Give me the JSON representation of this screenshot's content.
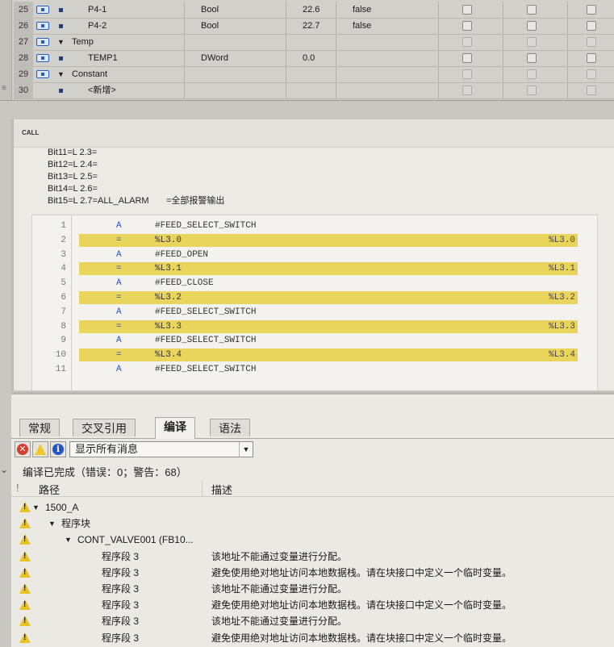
{
  "interface_table": {
    "rows": [
      {
        "num": "25",
        "kind": "var",
        "name": "P4-1",
        "type": "Bool",
        "offset": "22.6",
        "default": "false"
      },
      {
        "num": "26",
        "kind": "var",
        "name": "P4-2",
        "type": "Bool",
        "offset": "22.7",
        "default": "false"
      },
      {
        "num": "27",
        "kind": "section",
        "name": "Temp",
        "type": "",
        "offset": "",
        "default": ""
      },
      {
        "num": "28",
        "kind": "var",
        "name": "TEMP1",
        "type": "DWord",
        "offset": "0.0",
        "default": ""
      },
      {
        "num": "29",
        "kind": "section",
        "name": "Constant",
        "type": "",
        "offset": "",
        "default": ""
      },
      {
        "num": "30",
        "kind": "add",
        "name": "<新增>",
        "type": "",
        "offset": "",
        "default": ""
      }
    ]
  },
  "editor": {
    "call_label": "CALL",
    "comment_lines": [
      "Bit11=L 2.3=",
      "Bit12=L 2.4=",
      "Bit13=L 2.5=",
      "Bit14=L 2.6=",
      "Bit15=L 2.7=ALL_ALARM       =全部报警输出"
    ],
    "code_lines": [
      {
        "ln": "1",
        "op": "A",
        "arg": "#FEED_SELECT_SWITCH",
        "res": "",
        "hl": false
      },
      {
        "ln": "2",
        "op": "=",
        "arg": "%L3.0",
        "res": "%L3.0",
        "hl": true
      },
      {
        "ln": "3",
        "op": "A",
        "arg": "#FEED_OPEN",
        "res": "",
        "hl": false
      },
      {
        "ln": "4",
        "op": "=",
        "arg": "%L3.1",
        "res": "%L3.1",
        "hl": true
      },
      {
        "ln": "5",
        "op": "A",
        "arg": "#FEED_CLOSE",
        "res": "",
        "hl": false
      },
      {
        "ln": "6",
        "op": "=",
        "arg": "%L3.2",
        "res": "%L3.2",
        "hl": true
      },
      {
        "ln": "7",
        "op": "A",
        "arg": "#FEED_SELECT_SWITCH",
        "res": "",
        "hl": false
      },
      {
        "ln": "8",
        "op": "=",
        "arg": "%L3.3",
        "res": "%L3.3",
        "hl": true
      },
      {
        "ln": "9",
        "op": "A",
        "arg": "#FEED_SELECT_SWITCH",
        "res": "",
        "hl": false
      },
      {
        "ln": "10",
        "op": "=",
        "arg": "%L3.4",
        "res": "%L3.4",
        "hl": true
      },
      {
        "ln": "11",
        "op": "A",
        "arg": "#FEED_SELECT_SWITCH",
        "res": "",
        "hl": false
      }
    ]
  },
  "panel": {
    "tabs": [
      "常规",
      "交叉引用",
      "编译",
      "语法"
    ],
    "active_tab": "编译",
    "filter_value": "显示所有消息",
    "status": "编译已完成（错误：0；警告：68）",
    "header": {
      "path": "路径",
      "desc": "描述"
    },
    "messages": [
      {
        "level": 0,
        "path": "1500_A",
        "desc": ""
      },
      {
        "level": 1,
        "path": "程序块",
        "desc": ""
      },
      {
        "level": 2,
        "path": "CONT_VALVE001 (FB10...",
        "desc": ""
      },
      {
        "level": 3,
        "path": "程序段 3",
        "desc": "该地址不能通过变量进行分配。"
      },
      {
        "level": 3,
        "path": "程序段 3",
        "desc": "避免使用绝对地址访问本地数据栈。请在块接口中定义一个临时变量。"
      },
      {
        "level": 3,
        "path": "程序段 3",
        "desc": "该地址不能通过变量进行分配。"
      },
      {
        "level": 3,
        "path": "程序段 3",
        "desc": "避免使用绝对地址访问本地数据栈。请在块接口中定义一个临时变量。"
      },
      {
        "level": 3,
        "path": "程序段 3",
        "desc": "该地址不能通过变量进行分配。"
      },
      {
        "level": 3,
        "path": "程序段 3",
        "desc": "避免使用绝对地址访问本地数据栈。请在块接口中定义一个临时变量。"
      }
    ]
  },
  "colors": {
    "highlight": "#ead55c",
    "warning": "#e9c323",
    "error": "#d83a2f",
    "info": "#2551c9"
  }
}
